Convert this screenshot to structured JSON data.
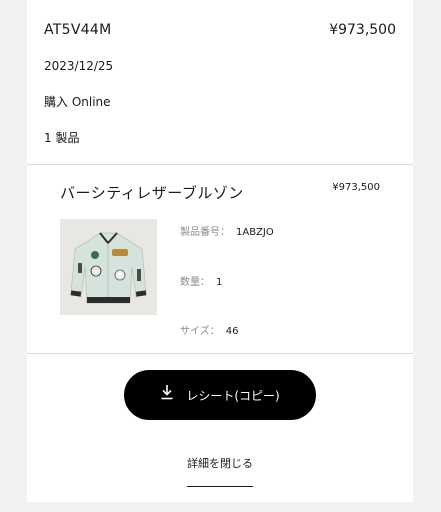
{
  "order": {
    "id": "AT5V44M",
    "total": "¥973,500",
    "date": "2023/12/25",
    "purchase_channel": "購入 Online",
    "item_count": "1 製品"
  },
  "product": {
    "name": "バーシティレザーブルゾン",
    "price": "¥973,500",
    "image_icon": "jacket-product-image",
    "details": [
      {
        "label": "製品番号：",
        "value": "1ABZJO"
      },
      {
        "label": "数量：",
        "value": "1"
      },
      {
        "label": "サイズ：",
        "value": "46"
      }
    ]
  },
  "actions": {
    "receipt_label": "レシート(コピー)",
    "receipt_icon": "download-icon",
    "close_label": "詳細を閉じる"
  },
  "colors": {
    "page_bg": "#f2f2f2",
    "card_bg": "#ffffff",
    "button_bg": "#000000",
    "button_text": "#ffffff",
    "muted_text": "#8a8a8a",
    "divider": "#d9d9d9"
  }
}
